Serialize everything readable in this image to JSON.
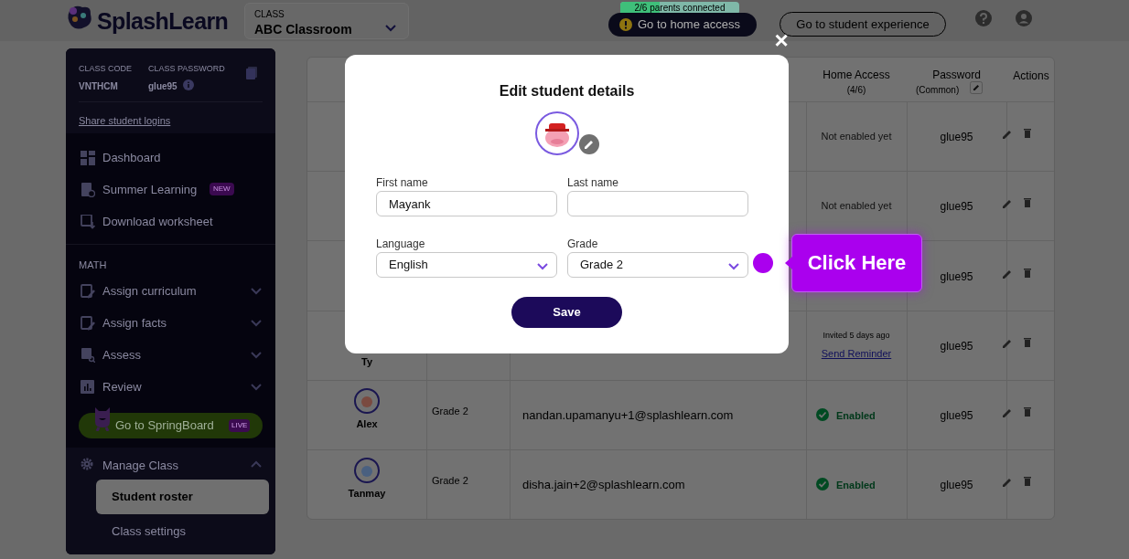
{
  "header": {
    "logo": "SplashLearn",
    "class_selector": {
      "label": "CLASS",
      "value": "ABC Classroom"
    },
    "parents_progress": {
      "text": "2/6 parents connected",
      "level": 0.33
    },
    "home_access_button": "Go to home access",
    "student_experience_button": "Go to student experience"
  },
  "sidebar": {
    "class_code": {
      "label": "CLASS CODE",
      "value": "VNTHCM"
    },
    "class_password": {
      "label": "CLASS PASSWORD",
      "value": "glue95"
    },
    "share_link": "Share student logins",
    "items": [
      {
        "label": "Dashboard",
        "kind": "grid"
      },
      {
        "label": "Summer Learning",
        "kind": "sheet",
        "badge": "NEW"
      },
      {
        "label": "Download worksheet",
        "kind": "download"
      }
    ],
    "section": "MATH",
    "math_items": [
      {
        "label": "Assign curriculum",
        "kind": "pen"
      },
      {
        "label": "Assign facts",
        "kind": "pen"
      },
      {
        "label": "Assess",
        "kind": "search"
      },
      {
        "label": "Review",
        "kind": "chart"
      }
    ],
    "springboard": {
      "label": "Go to SpringBoard",
      "badge": "LIVE"
    },
    "manage": {
      "label": "Manage Class",
      "expanded": true,
      "children": [
        {
          "label": "Student roster",
          "selected": true
        },
        {
          "label": "Class settings",
          "selected": false
        }
      ]
    }
  },
  "table": {
    "columns": [
      {
        "title": "Home Access",
        "note": "(4/6)"
      },
      {
        "title": "Password",
        "note": "(Common)"
      },
      {
        "title": "Actions"
      }
    ],
    "rows": [
      {
        "home_access": {
          "kind": "text",
          "text": "Not enabled yet"
        },
        "password": "glue95"
      },
      {
        "home_access": {
          "kind": "text",
          "text": "Not enabled yet"
        },
        "password": "glue95"
      },
      {
        "password": "glue95"
      },
      {
        "name": "Ty",
        "home_access": {
          "kind": "invited",
          "text": "Invited 5 days ago",
          "link": "Send Reminder"
        },
        "password": "glue95"
      },
      {
        "name": "Alex",
        "grade": "Grade 2",
        "email": "nandan.upamanyu+1@splashlearn.com",
        "home_access": {
          "kind": "enabled",
          "text": "Enabled"
        },
        "password": "glue95"
      },
      {
        "name": "Tanmay",
        "grade": "Grade 2",
        "email": "disha.jain+2@splashlearn.com",
        "home_access": {
          "kind": "enabled",
          "text": "Enabled"
        },
        "password": "glue95"
      }
    ]
  },
  "modal": {
    "title": "Edit student details",
    "close": "×",
    "fields": [
      {
        "label": "First name",
        "value": "Mayank",
        "kind": "text"
      },
      {
        "label": "Last name",
        "kind": "text"
      },
      {
        "label": "Language",
        "value": "English",
        "kind": "select"
      },
      {
        "label": "Grade",
        "value": "Grade 2",
        "kind": "select"
      }
    ],
    "save": "Save"
  },
  "callout": {
    "text": "Click Here"
  }
}
